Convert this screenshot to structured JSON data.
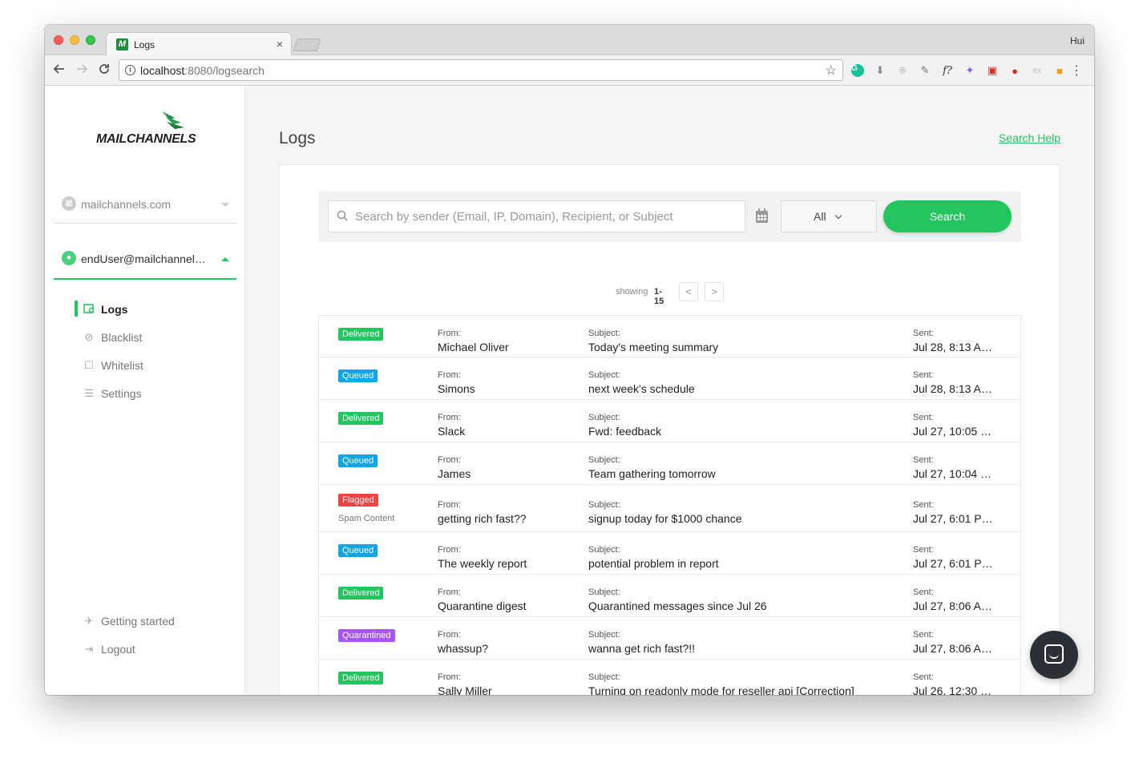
{
  "browser": {
    "tab_title": "Logs",
    "tab_favicon": "M",
    "tab_close": "×",
    "user": "Hui",
    "url_host": "localhost",
    "url_path": ":8080/logsearch",
    "icons": {
      "back": "arrow-left-icon",
      "forward": "arrow-right-icon",
      "reload": "reload-icon",
      "info": "info-icon",
      "star": "star-icon",
      "menu": "kebab-menu-icon"
    }
  },
  "sidebar": {
    "logo_text": "MAILCHANNELS",
    "domain": "mailchannels.com",
    "user": "endUser@mailchannel…",
    "nav": [
      {
        "label": "Logs",
        "icon": "logs-icon",
        "active": true
      },
      {
        "label": "Blacklist",
        "icon": "block-icon"
      },
      {
        "label": "Whitelist",
        "icon": "edit-icon"
      },
      {
        "label": "Settings",
        "icon": "sliders-icon"
      }
    ],
    "footer_nav": [
      {
        "label": "Getting started",
        "icon": "plane-icon"
      },
      {
        "label": "Logout",
        "icon": "logout-icon"
      }
    ]
  },
  "main": {
    "title": "Logs",
    "search_help": "Search Help",
    "search": {
      "placeholder": "Search by sender (Email, IP, Domain), Recipient, or Subject",
      "filter_value": "All",
      "button_label": "Search"
    },
    "pager": {
      "label": "showing",
      "range": "1-15",
      "prev": "<",
      "next": ">"
    },
    "columns": {
      "from": "From:",
      "subject": "Subject:",
      "sent": "Sent:"
    },
    "rows": [
      {
        "status": "Delivered",
        "status_class": "delivered",
        "from": "Michael Oliver",
        "subject": "Today's meeting summary",
        "sent": "Jul 28, 8:13 A…"
      },
      {
        "status": "Queued",
        "status_class": "queued",
        "from": "Simons",
        "subject": "next week's schedule",
        "sent": "Jul 28, 8:13 A…"
      },
      {
        "status": "Delivered",
        "status_class": "delivered",
        "from": "Slack",
        "subject": "Fwd: feedback",
        "sent": "Jul 27, 10:05 …"
      },
      {
        "status": "Queued",
        "status_class": "queued",
        "from": "James",
        "subject": "Team gathering tomorrow",
        "sent": "Jul 27, 10:04 …"
      },
      {
        "status": "Flagged",
        "status_class": "flagged",
        "status_note": "Spam Content",
        "from": "getting rich fast??",
        "subject": "signup today for $1000 chance",
        "sent": "Jul 27, 6:01 P…"
      },
      {
        "status": "Queued",
        "status_class": "queued",
        "from": "The weekly report",
        "subject": "potential problem in report",
        "sent": "Jul 27, 6:01 P…"
      },
      {
        "status": "Delivered",
        "status_class": "delivered",
        "from": "Quarantine digest",
        "subject": "Quarantined messages since Jul 26",
        "sent": "Jul 27, 8:06 A…"
      },
      {
        "status": "Quarantined",
        "status_class": "quarantined",
        "from": "whassup?",
        "subject": "wanna get rich fast?!!",
        "sent": "Jul 27, 8:06 A…"
      },
      {
        "status": "Delivered",
        "status_class": "delivered",
        "from": "Sally Miller",
        "subject": "Turning on readonly mode for reseller api [Correction]",
        "sent": "Jul 26, 12:30 …"
      }
    ]
  },
  "colors": {
    "accent": "#22c55e",
    "queued": "#0ea5e9",
    "flagged": "#ef4444",
    "quarantined": "#a855f7"
  }
}
